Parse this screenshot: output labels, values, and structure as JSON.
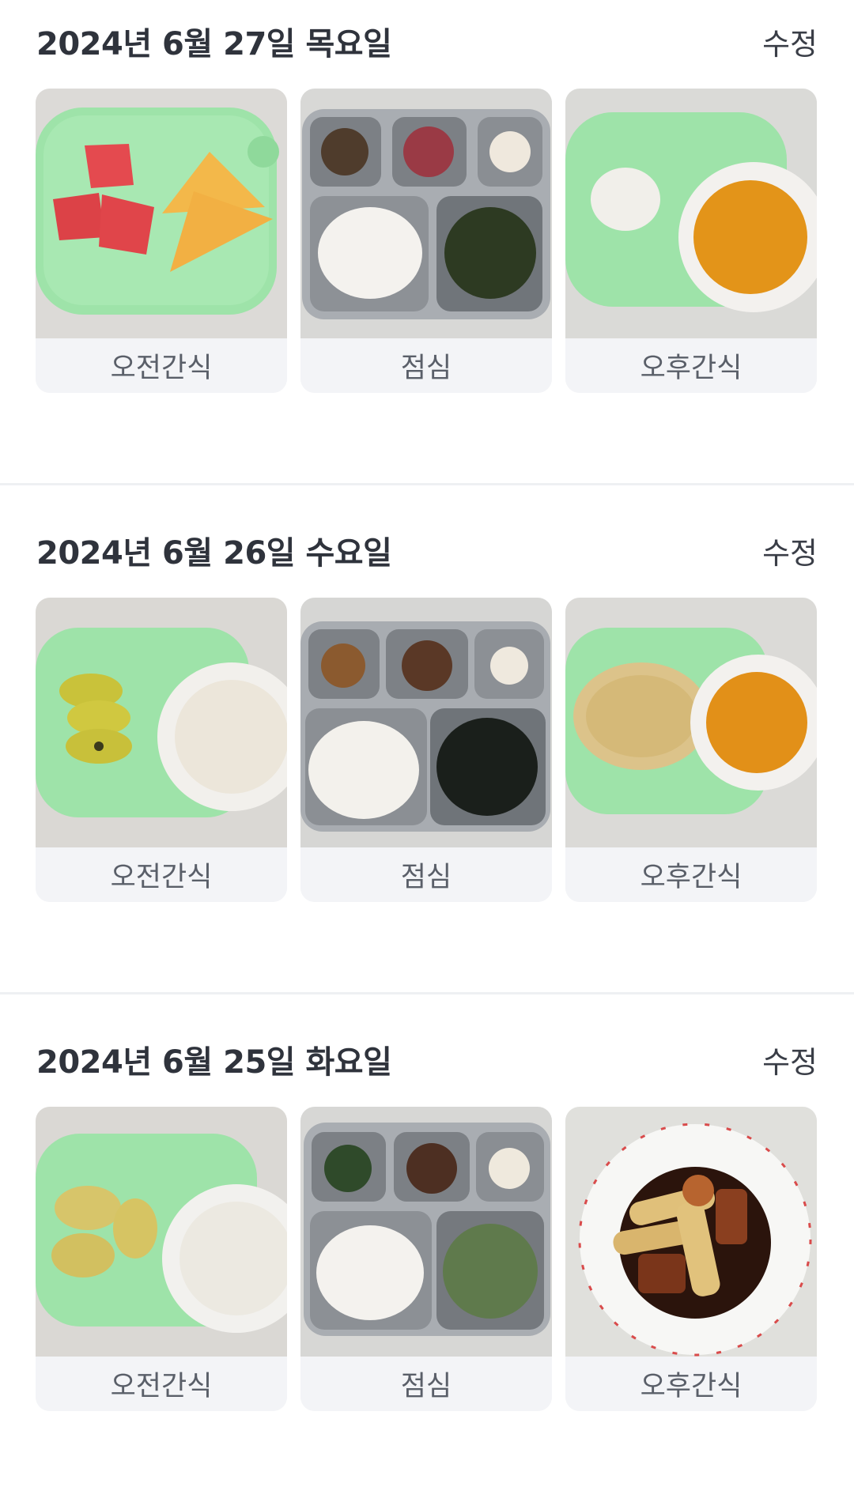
{
  "colors": {
    "background": "#ffffff",
    "title_text": "#2f333c",
    "label_bg": "#f3f4f7",
    "label_text": "#5a5f69",
    "divider": "#eef0f3",
    "tray_green": "#9ee3a9",
    "steel_tray": "#b9bcc0"
  },
  "days": [
    {
      "title": "2024년 6월 27일 목요일",
      "edit_label": "수정",
      "meals": [
        {
          "label": "오전간식",
          "icon": "fruit-cheese-tray-photo"
        },
        {
          "label": "점심",
          "icon": "lunch-steel-tray-photo"
        },
        {
          "label": "오후간식",
          "icon": "egg-juice-tray-photo"
        }
      ]
    },
    {
      "title": "2024년 6월 26일 수요일",
      "edit_label": "수정",
      "meals": [
        {
          "label": "오전간식",
          "icon": "kiwi-milk-tray-photo"
        },
        {
          "label": "점심",
          "icon": "lunch-steel-tray-photo"
        },
        {
          "label": "오후간식",
          "icon": "pancake-juice-tray-photo"
        }
      ]
    },
    {
      "title": "2024년 6월 25일 화요일",
      "edit_label": "수정",
      "meals": [
        {
          "label": "오전간식",
          "icon": "banana-milk-tray-photo"
        },
        {
          "label": "점심",
          "icon": "lunch-steel-tray-photo"
        },
        {
          "label": "오후간식",
          "icon": "tteokbokki-bowl-photo"
        }
      ]
    }
  ]
}
